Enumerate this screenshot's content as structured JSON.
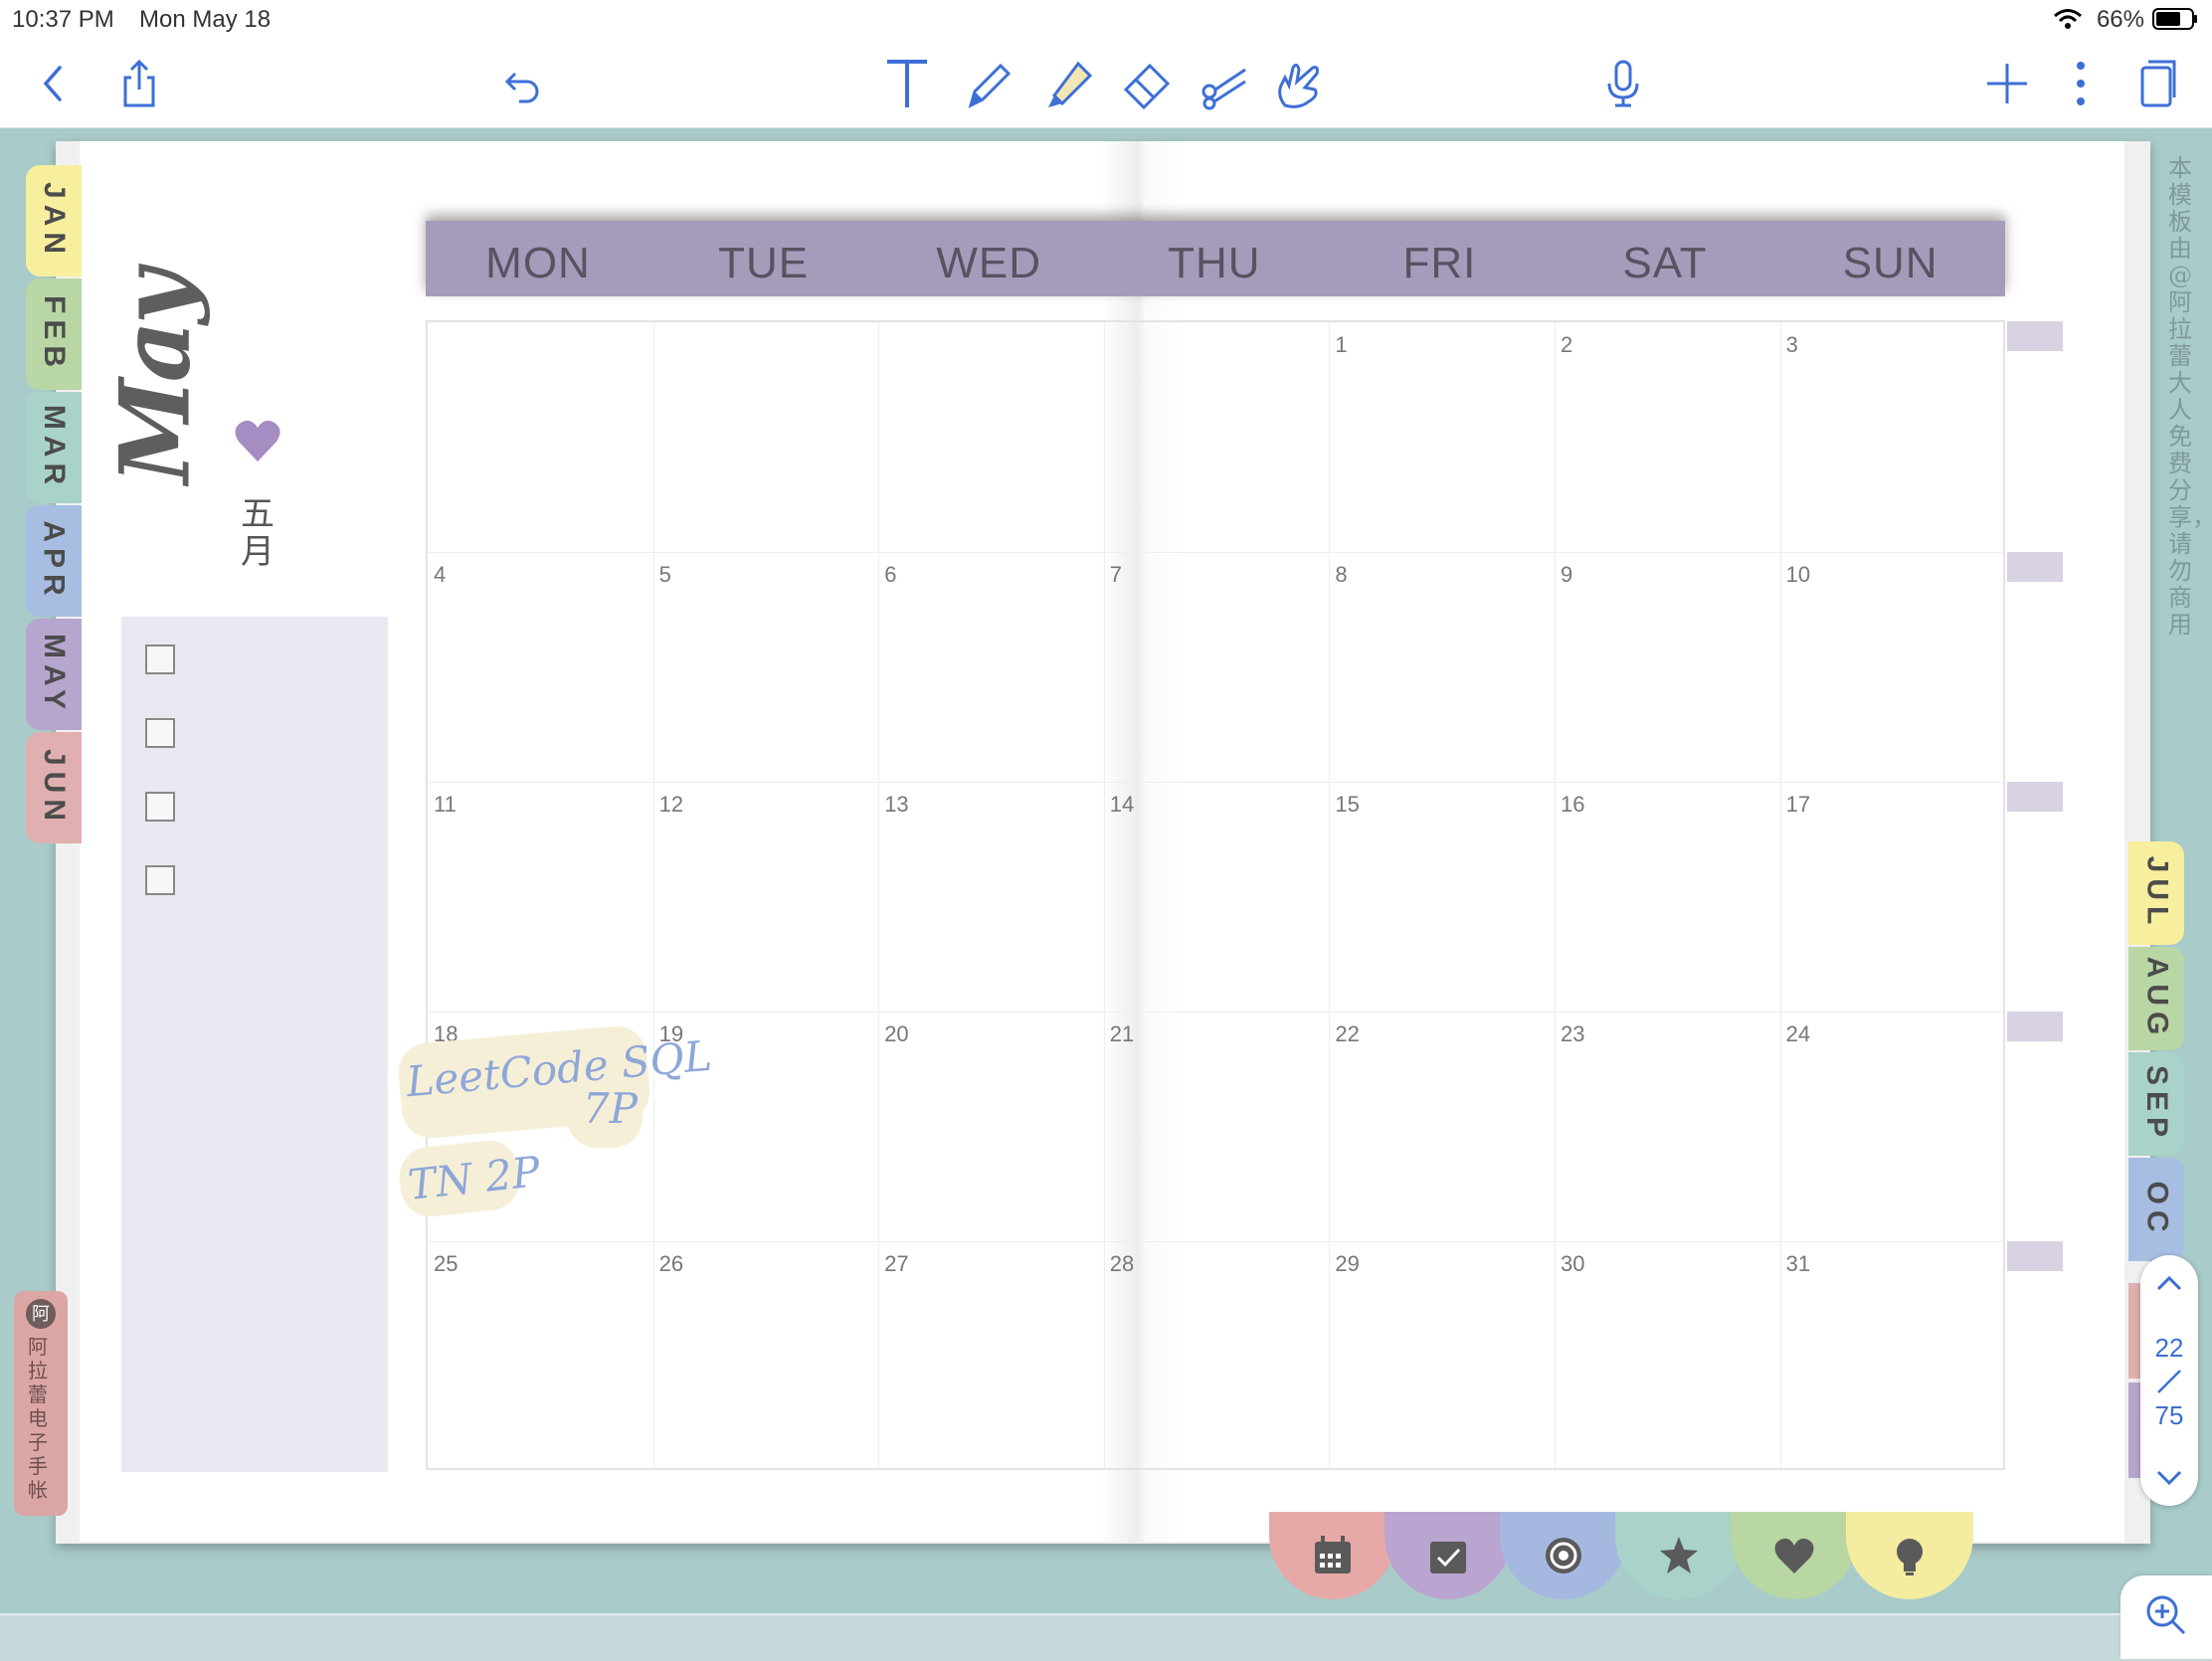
{
  "status_bar": {
    "time": "10:37 PM",
    "date": "Mon May 18",
    "battery": "66%"
  },
  "toolbar": {
    "left": [
      "back-icon",
      "share-icon",
      "undo-icon"
    ],
    "tools": [
      "text-tool-icon",
      "pen-icon",
      "highlighter-icon",
      "eraser-icon",
      "lasso-icon",
      "hand-pointer-icon"
    ],
    "right": [
      "microphone-icon",
      "add-icon",
      "more-icon",
      "page-view-icon"
    ],
    "accent": "#3d6fd6"
  },
  "month": {
    "name": "May",
    "chinese": "五月"
  },
  "weekdays": [
    "MON",
    "TUE",
    "WED",
    "THU",
    "FRI",
    "SAT",
    "SUN"
  ],
  "weeks": [
    [
      "",
      "",
      "",
      "",
      "1",
      "2",
      "3"
    ],
    [
      "4",
      "5",
      "6",
      "7",
      "8",
      "9",
      "10"
    ],
    [
      "11",
      "12",
      "13",
      "14",
      "15",
      "16",
      "17"
    ],
    [
      "18",
      "19",
      "20",
      "21",
      "22",
      "23",
      "24"
    ],
    [
      "25",
      "26",
      "27",
      "28",
      "29",
      "30",
      "31"
    ]
  ],
  "notes": {
    "line1": "LeetCode SQL",
    "line2": "7P",
    "line3": "TN 2P"
  },
  "left_tabs": [
    {
      "label": "JAN",
      "color": "#f7ef9d"
    },
    {
      "label": "FEB",
      "color": "#b9d7a4"
    },
    {
      "label": "MAR",
      "color": "#a9d3c9"
    },
    {
      "label": "APR",
      "color": "#a7bde2"
    },
    {
      "label": "MAY",
      "color": "#b6a6cd"
    },
    {
      "label": "JUN",
      "color": "#e0b0b0"
    }
  ],
  "right_tabs": [
    {
      "label": "JUL",
      "color": "#f7ef9d"
    },
    {
      "label": "AUG",
      "color": "#b9d7a4"
    },
    {
      "label": "SEP",
      "color": "#a9d3c9"
    },
    {
      "label": "OC",
      "color": "#a7bde2"
    }
  ],
  "side_note": "本模板由@阿拉蕾大人免费分享，请勿商用",
  "brand": "阿拉蕾电子手帐",
  "brand_logo": "阿",
  "pager": {
    "current": "22",
    "total": "75"
  },
  "bottom_icons": [
    {
      "icon": "calendar-icon",
      "color": "#e6a9a7"
    },
    {
      "icon": "checklist-icon",
      "color": "#b9a5cf"
    },
    {
      "icon": "at-sign-icon",
      "color": "#a5b8e0"
    },
    {
      "icon": "star-icon",
      "color": "#a8d2ca"
    },
    {
      "icon": "heart-icon",
      "color": "#b8d7a2"
    },
    {
      "icon": "lightbulb-icon",
      "color": "#f4ec9f"
    }
  ]
}
